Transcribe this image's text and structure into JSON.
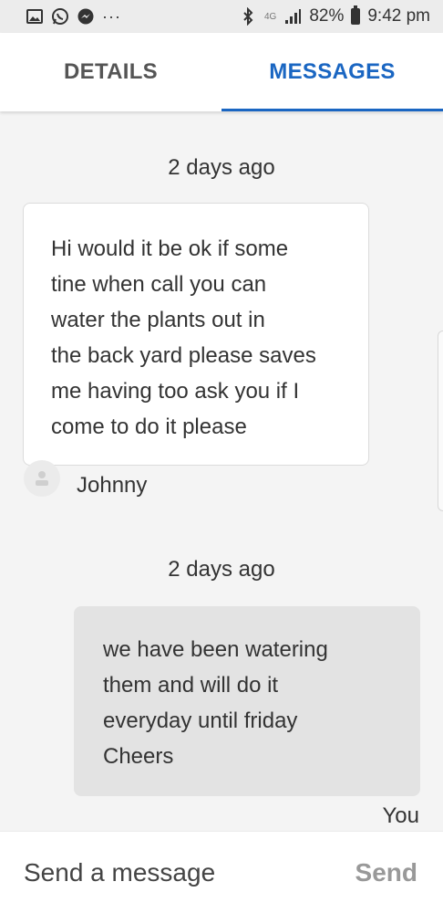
{
  "status_bar": {
    "icons_left": [
      "gallery-icon",
      "whatsapp-icon",
      "messenger-icon",
      "more-dots-icon"
    ],
    "dots": "···",
    "network": "4G",
    "battery": "82%",
    "time": "9:42 pm"
  },
  "tabs": [
    {
      "label": "DETAILS",
      "active": false
    },
    {
      "label": "MESSAGES",
      "active": true
    }
  ],
  "messages": [
    {
      "timestamp": "2 days ago",
      "direction": "incoming",
      "lines": [
        "Hi would it be ok if some",
        "tine when call you can",
        "water the plants out in",
        "the back yard please saves",
        "me having too ask you if I",
        "come to do it please"
      ],
      "sender": "Johnny"
    },
    {
      "timestamp": "2 days ago",
      "direction": "outgoing",
      "lines": [
        "we have been watering",
        "them and will do it",
        "everyday until friday",
        "Cheers"
      ],
      "sender": "You"
    }
  ],
  "composer": {
    "placeholder": "Send a message",
    "send_label": "Send"
  },
  "colors": {
    "accent": "#1a66c2",
    "incoming_bubble": "#ffffff",
    "outgoing_bubble": "#e3e3e3",
    "background": "#f4f4f4"
  }
}
